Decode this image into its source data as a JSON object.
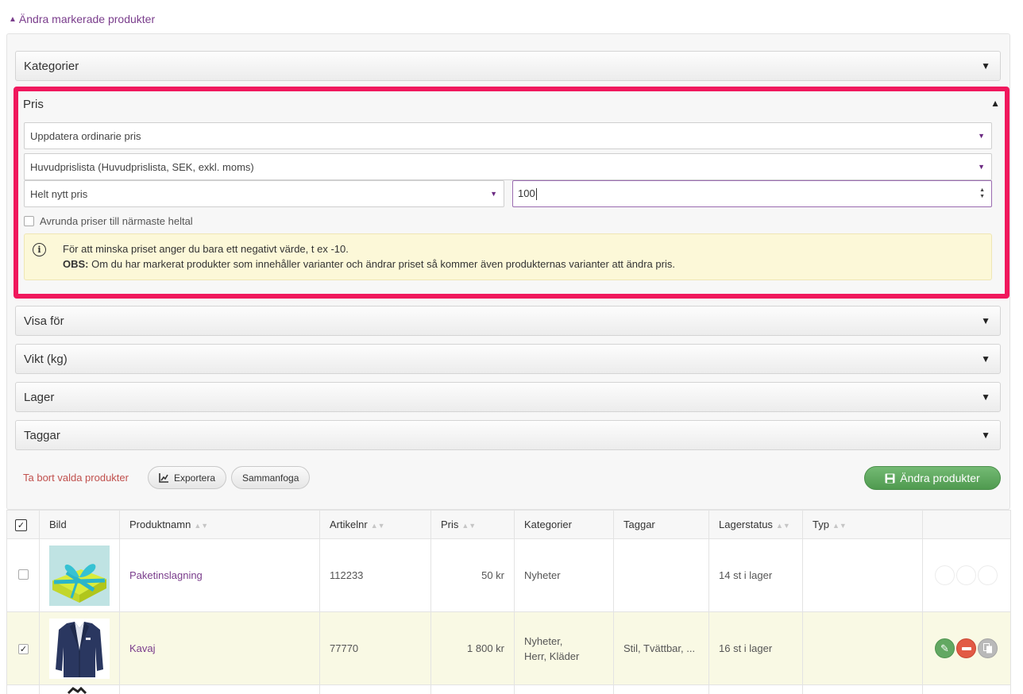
{
  "toggle": {
    "label": "Ändra markerade produkter"
  },
  "accordions": {
    "kategorier": "Kategorier",
    "pris": "Pris",
    "visa_for": "Visa för",
    "vikt": "Vikt (kg)",
    "lager": "Lager",
    "taggar": "Taggar"
  },
  "pris": {
    "update_select": "Uppdatera ordinarie pris",
    "pricelist_select": "Huvudprislista (Huvudprislista, SEK, exkl. moms)",
    "mode_select": "Helt nytt pris",
    "price_value": "100",
    "round_label": "Avrunda priser till närmaste heltal",
    "info_line1": "För att minska priset anger du bara ett negativt värde, t ex -10.",
    "info_obs_label": "OBS:",
    "info_line2": " Om du har markerat produkter som innehåller varianter och ändrar priset så kommer även produkternas varianter att ändra pris."
  },
  "actions": {
    "delete_label": "Ta bort valda produkter",
    "export_label": "Exportera",
    "merge_label": "Sammanfoga",
    "change_label": "Ändra produkter"
  },
  "table": {
    "headers": {
      "bild": "Bild",
      "produktnamn": "Produktnamn",
      "artikelnr": "Artikelnr",
      "pris": "Pris",
      "kategorier": "Kategorier",
      "taggar": "Taggar",
      "lagerstatus": "Lagerstatus",
      "typ": "Typ"
    },
    "rows": [
      {
        "checked": false,
        "name": "Paketinslagning",
        "artikelnr": "112233",
        "pris": "50 kr",
        "kategorier_1": "Nyheter",
        "kategorier_2": "",
        "taggar": "",
        "lagerstatus": "14 st i lager",
        "typ": ""
      },
      {
        "checked": true,
        "name": "Kavaj",
        "artikelnr": "77770",
        "pris": "1 800 kr",
        "kategorier_1": "Nyheter,",
        "kategorier_2": "Herr, Kläder",
        "taggar": "Stil, Tvättbar, ...",
        "lagerstatus": "16 st i lager",
        "typ": ""
      }
    ]
  },
  "colors": {
    "accent_purple": "#7a3d8c",
    "highlight_border": "#f0185d",
    "green_button": "#5fa85f",
    "delete_red": "#c0504d",
    "info_bg": "#fcf8d8"
  }
}
